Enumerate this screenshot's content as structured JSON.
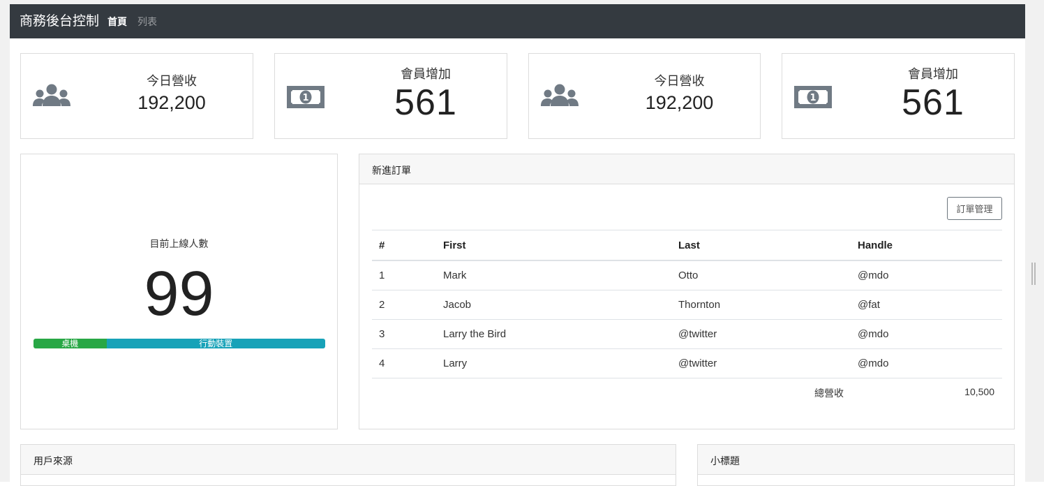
{
  "navbar": {
    "brand": "商務後台控制",
    "links": [
      "首頁",
      "列表"
    ]
  },
  "stats": [
    {
      "label": "今日營收",
      "value": "192,200",
      "icon": "users-icon"
    },
    {
      "label": "會員增加",
      "value": "561",
      "icon": "money-bill-icon"
    },
    {
      "label": "今日營收",
      "value": "192,200",
      "icon": "users-icon"
    },
    {
      "label": "會員增加",
      "value": "561",
      "icon": "money-bill-icon"
    }
  ],
  "online": {
    "label": "目前上線人數",
    "count": "99",
    "devices": [
      {
        "label": "桌機",
        "percent": 25,
        "color": "#28a745"
      },
      {
        "label": "行動裝置",
        "percent": 75,
        "color": "#17a2b8"
      }
    ]
  },
  "orders": {
    "title": "新進訂單",
    "manage_button": "訂單管理",
    "columns": [
      "#",
      "First",
      "Last",
      "Handle"
    ],
    "rows": [
      [
        "1",
        "Mark",
        "Otto",
        "@mdo"
      ],
      [
        "2",
        "Jacob",
        "Thornton",
        "@fat"
      ],
      [
        "3",
        "Larry the Bird",
        "@twitter",
        "@mdo"
      ],
      [
        "4",
        "Larry",
        "@twitter",
        "@mdo"
      ]
    ],
    "total_label": "總營收",
    "total_value": "10,500"
  },
  "sources": {
    "title": "用戶來源"
  },
  "subtitle_card": {
    "title": "小標題"
  },
  "colors": {
    "navbar": "#343a40",
    "desktop": "#28a745",
    "mobile": "#17a2b8",
    "icon": "#707a84"
  }
}
